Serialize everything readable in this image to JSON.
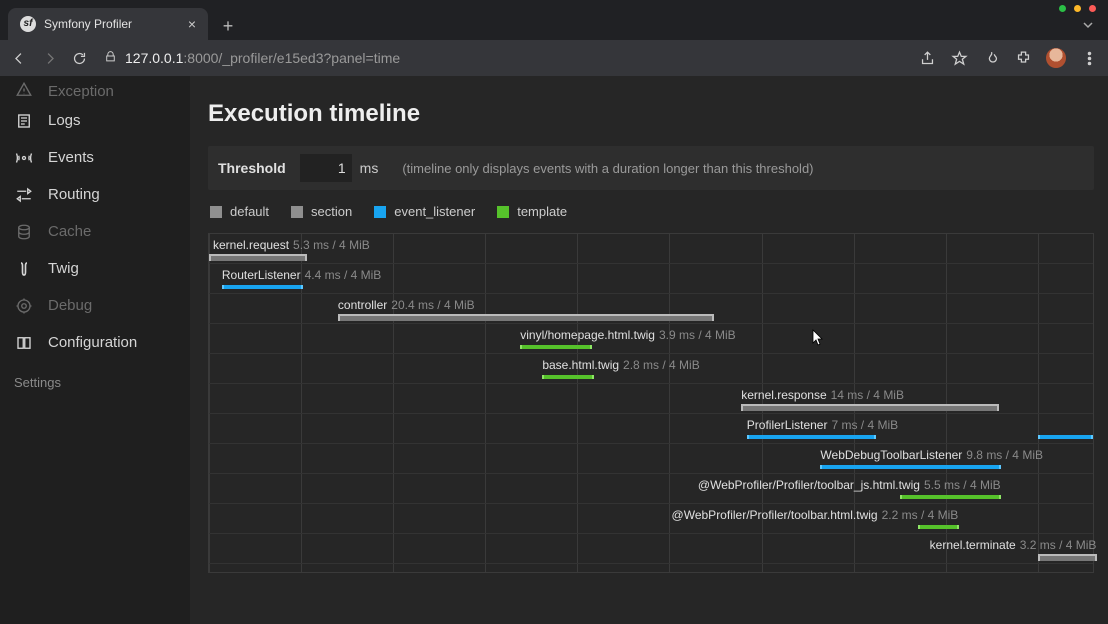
{
  "browser": {
    "tab_title": "Symfony Profiler",
    "url_host": "127.0.0.1",
    "url_rest": ":8000/_profiler/e15ed3?panel=time"
  },
  "sidebar": {
    "items": [
      {
        "label": "Exception",
        "dim": true,
        "cut": true
      },
      {
        "label": "Logs",
        "dim": false,
        "cut": false
      },
      {
        "label": "Events",
        "dim": false,
        "cut": false
      },
      {
        "label": "Routing",
        "dim": false,
        "cut": false
      },
      {
        "label": "Cache",
        "dim": true,
        "cut": false
      },
      {
        "label": "Twig",
        "dim": false,
        "cut": false
      },
      {
        "label": "Debug",
        "dim": true,
        "cut": false
      },
      {
        "label": "Configuration",
        "dim": false,
        "cut": false
      }
    ],
    "settings_label": "Settings"
  },
  "page": {
    "title": "Execution timeline",
    "threshold_label": "Threshold",
    "threshold_value": "1",
    "threshold_unit": "ms",
    "threshold_hint": "(timeline only displays events with a duration longer than this threshold)"
  },
  "legend": [
    {
      "key": "default",
      "label": "default"
    },
    {
      "key": "section",
      "label": "section"
    },
    {
      "key": "event",
      "label": "event_listener"
    },
    {
      "key": "template",
      "label": "template"
    }
  ],
  "chart_data": {
    "type": "bar",
    "title": "Execution timeline",
    "xlabel": "ms",
    "ylabel": "",
    "x_range_ms": 48,
    "gridlines_ms": [
      0,
      5,
      10,
      15,
      20,
      25,
      30,
      35,
      40,
      45
    ],
    "events": [
      {
        "name": "kernel.request",
        "category": "section",
        "start_ms": 0.0,
        "duration_ms": 5.3,
        "memory": "4 MiB"
      },
      {
        "name": "RouterListener",
        "category": "event",
        "start_ms": 0.7,
        "duration_ms": 4.4,
        "memory": "4 MiB"
      },
      {
        "name": "controller",
        "category": "section",
        "start_ms": 7.0,
        "duration_ms": 20.4,
        "memory": "4 MiB"
      },
      {
        "name": "vinyl/homepage.html.twig",
        "category": "template",
        "start_ms": 16.9,
        "duration_ms": 3.9,
        "memory": "4 MiB"
      },
      {
        "name": "base.html.twig",
        "category": "template",
        "start_ms": 18.1,
        "duration_ms": 2.8,
        "memory": "4 MiB"
      },
      {
        "name": "kernel.response",
        "category": "section",
        "start_ms": 28.9,
        "duration_ms": 14.0,
        "memory": "4 MiB"
      },
      {
        "name": "ProfilerListener",
        "category": "event",
        "start_ms": 29.2,
        "duration_ms": 7.0,
        "memory": "4 MiB",
        "extra_bar": {
          "start_ms": 45.0,
          "duration_ms": 3.0
        }
      },
      {
        "name": "WebDebugToolbarListener",
        "category": "event",
        "start_ms": 33.2,
        "duration_ms": 9.8,
        "memory": "4 MiB"
      },
      {
        "name": "@WebProfiler/Profiler/toolbar_js.html.twig",
        "category": "template",
        "start_ms": 37.5,
        "duration_ms": 5.5,
        "memory": "4 MiB"
      },
      {
        "name": "@WebProfiler/Profiler/toolbar.html.twig",
        "category": "template",
        "start_ms": 38.5,
        "duration_ms": 2.2,
        "memory": "4 MiB"
      },
      {
        "name": "kernel.terminate",
        "category": "section",
        "start_ms": 45.0,
        "duration_ms": 3.2,
        "memory": "4 MiB"
      }
    ]
  }
}
